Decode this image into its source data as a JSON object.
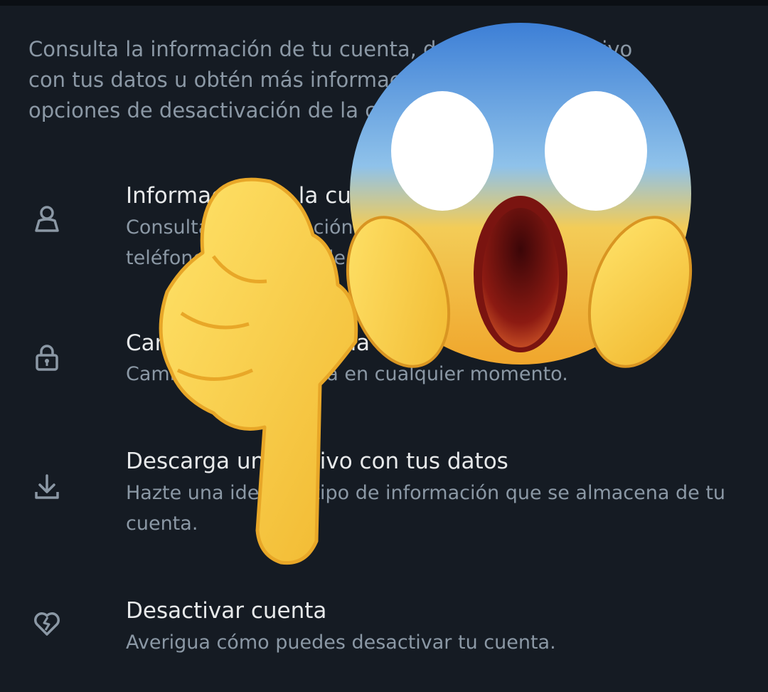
{
  "intro": "Consulta la información de tu cuenta, descarga un archivo con tus datos u obtén más información acerca de las opciones de desactivación de la cuenta.",
  "items": [
    {
      "title": "Información de la cuenta",
      "desc": "Consulta la información de tu cuenta, como tu número de teléfono y dirección de correo electrónico.",
      "icon": "person-icon"
    },
    {
      "title": "Cambia tu contraseña",
      "desc": "Cambia tu contraseña en cualquier momento.",
      "icon": "lock-icon"
    },
    {
      "title": "Descarga un archivo con tus datos",
      "desc": "Hazte una idea del tipo de información que se almacena de tu cuenta.",
      "icon": "download-icon"
    },
    {
      "title": "Desactivar cuenta",
      "desc": "Averigua cómo puedes desactivar tu cuenta.",
      "icon": "broken-heart-icon"
    }
  ],
  "overlay": {
    "emojis": [
      "screaming-face-emoji",
      "pointing-down-hand-emoji"
    ]
  },
  "colors": {
    "background": "#151b23",
    "primary_text": "#e7e9ea",
    "secondary_text": "#8b98a5"
  }
}
